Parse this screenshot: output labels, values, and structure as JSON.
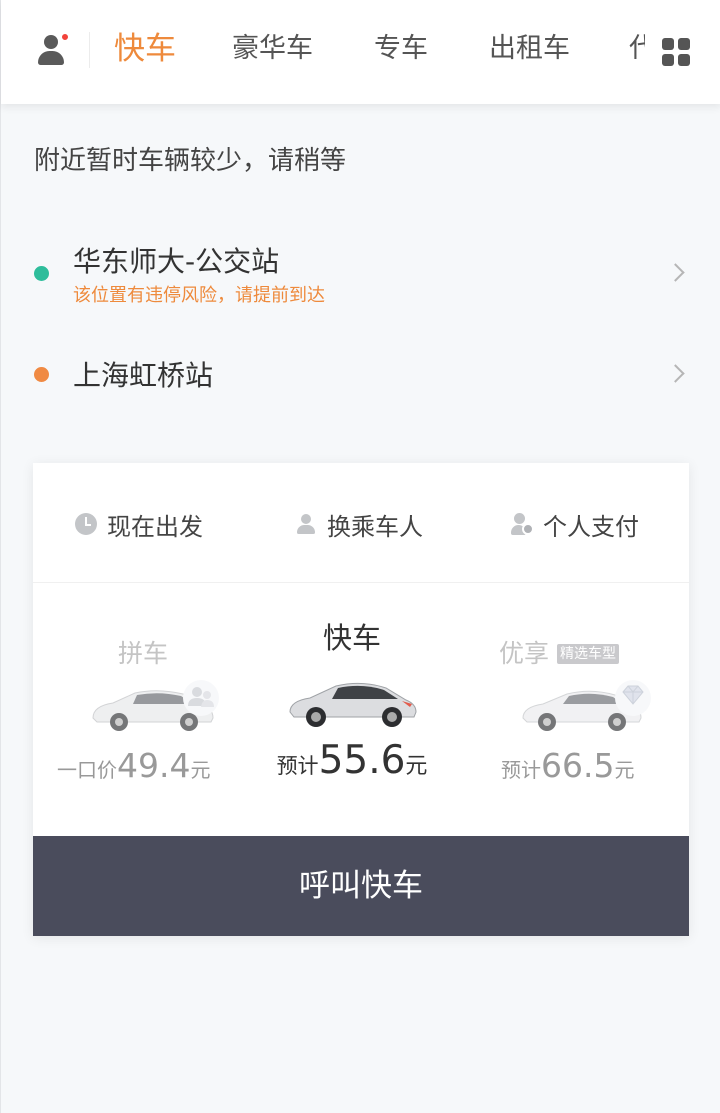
{
  "tabs": [
    {
      "label": "快车",
      "active": true
    },
    {
      "label": "豪华车"
    },
    {
      "label": "专车"
    },
    {
      "label": "出租车"
    },
    {
      "label": "代"
    }
  ],
  "notice": "附近暂时车辆较少，请稍等",
  "pickup": {
    "name": "华东师大-公交站",
    "warning": "该位置有违停风险，请提前到达",
    "dot_color": "#2ebd9b"
  },
  "destination": {
    "name": "上海虹桥站",
    "dot_color": "#f08a43"
  },
  "options": {
    "depart": "现在出发",
    "passenger": "换乘车人",
    "payment": "个人支付"
  },
  "cars": [
    {
      "title": "拼车",
      "price_prefix": "一口价",
      "price": "49.4",
      "unit": "元",
      "icon": "carpool-people-icon"
    },
    {
      "title": "快车",
      "price_prefix": "预计",
      "price": "55.6",
      "unit": "元",
      "selected": true
    },
    {
      "title": "优享",
      "badge": "精选车型",
      "price_prefix": "预计",
      "price": "66.5",
      "unit": "元",
      "icon": "diamond-icon"
    }
  ],
  "call_button": "呼叫快车",
  "colors": {
    "accent": "#ee8a3c",
    "call_button_bg": "#4a4c5c",
    "notification_dot": "#f2423a"
  }
}
